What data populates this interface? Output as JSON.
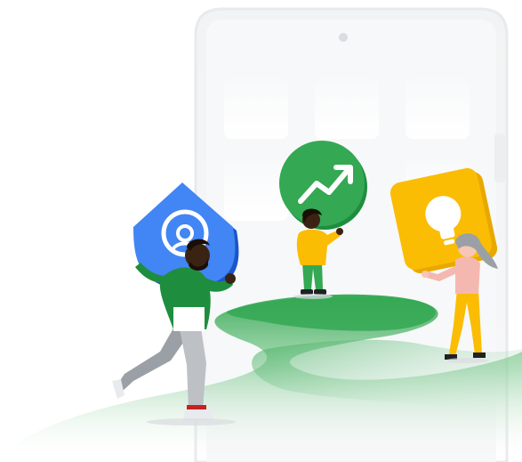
{
  "scene": {
    "kind": "illustration",
    "icons": {
      "shield": "user-shield-icon",
      "growth": "trending-up-icon",
      "idea": "lightbulb-icon"
    },
    "colors": {
      "background": "#ffffff",
      "phone_body": "#f1f3f4",
      "phone_tile": "#f8f9fa",
      "path_green": "#34a853",
      "shield_blue": "#4285f4",
      "growth_green": "#34a853",
      "idea_yellow": "#fbbc04",
      "person_skin_dark": "#3b2314",
      "person_skin_light": "#f6c7b4",
      "shirt_green": "#1e8e3e",
      "shirt_yellow": "#fbbc04",
      "shirt_pink": "#f4b8b0",
      "pants_grey": "#9aa0a6",
      "pants_green": "#34a853",
      "pants_yellow": "#fbbc04",
      "hair_grey": "#9aa0a6"
    }
  }
}
